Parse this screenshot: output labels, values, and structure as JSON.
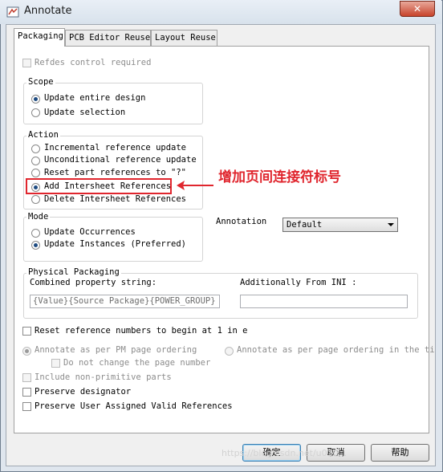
{
  "window": {
    "title": "Annotate",
    "close_glyph": "✕"
  },
  "tabs": [
    {
      "label": "Packaging"
    },
    {
      "label": "PCB Editor Reuse"
    },
    {
      "label": "Layout Reuse"
    }
  ],
  "packaging": {
    "refdes_control": "Refdes control required",
    "scope": {
      "label": "Scope",
      "options": [
        "Update entire design",
        "Update selection"
      ]
    },
    "action": {
      "label": "Action",
      "options": [
        "Incremental reference update",
        "Unconditional reference update",
        "Reset part references to \"?\"",
        "Add Intersheet References",
        "Delete Intersheet References"
      ]
    },
    "mode": {
      "label": "Mode",
      "options": [
        "Update Occurrences",
        "Update Instances (Preferred)"
      ]
    },
    "annotation": {
      "label": "Annotation",
      "selected": "Default"
    },
    "physical_packaging": {
      "label": "Physical Packaging",
      "combined_label": "Combined property string:",
      "combined_value": "{Value}{Source Package}{POWER_GROUP}",
      "additionally_label": "Additionally From INI :",
      "additionally_value": ""
    },
    "reset_numbers": "Reset reference numbers to begin at 1 in e",
    "annotate_pm": "Annotate as per PM page ordering",
    "annotate_page": "Annotate as per page ordering in the ti",
    "do_not_change": "Do not change the page number",
    "include_nonprimitive": "Include non-primitive parts",
    "preserve_designator": "Preserve designator",
    "preserve_user": "Preserve User Assigned Valid References"
  },
  "buttons": {
    "ok": "确定",
    "cancel": "取消",
    "help": "帮助"
  },
  "callout": {
    "text": "增加页间连接符标号",
    "color": "#e0262e"
  },
  "watermark": "https://blog.csdn.net/u010..."
}
